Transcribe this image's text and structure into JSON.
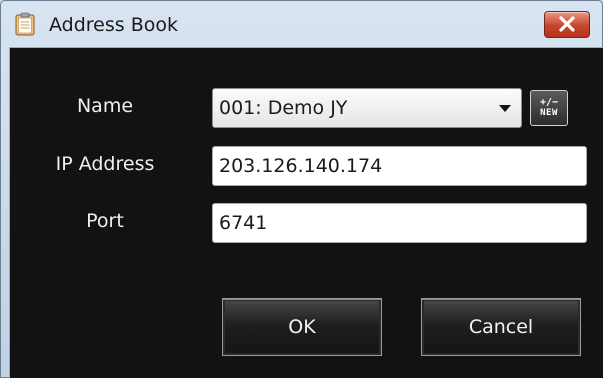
{
  "window": {
    "title": "Address Book",
    "close_icon": "close-icon"
  },
  "form": {
    "name_label": "Name",
    "name_value": "001: Demo JY",
    "new_button": {
      "line1": "+/−",
      "line2": "NEW"
    },
    "ip_label": "IP Address",
    "ip_value": "203.126.140.174",
    "port_label": "Port",
    "port_value": "6741"
  },
  "buttons": {
    "ok_label": "OK",
    "cancel_label": "Cancel"
  },
  "colors": {
    "client_background": "#121212",
    "titlebar": "#c9d9ea",
    "close_button": "#c7452d"
  }
}
